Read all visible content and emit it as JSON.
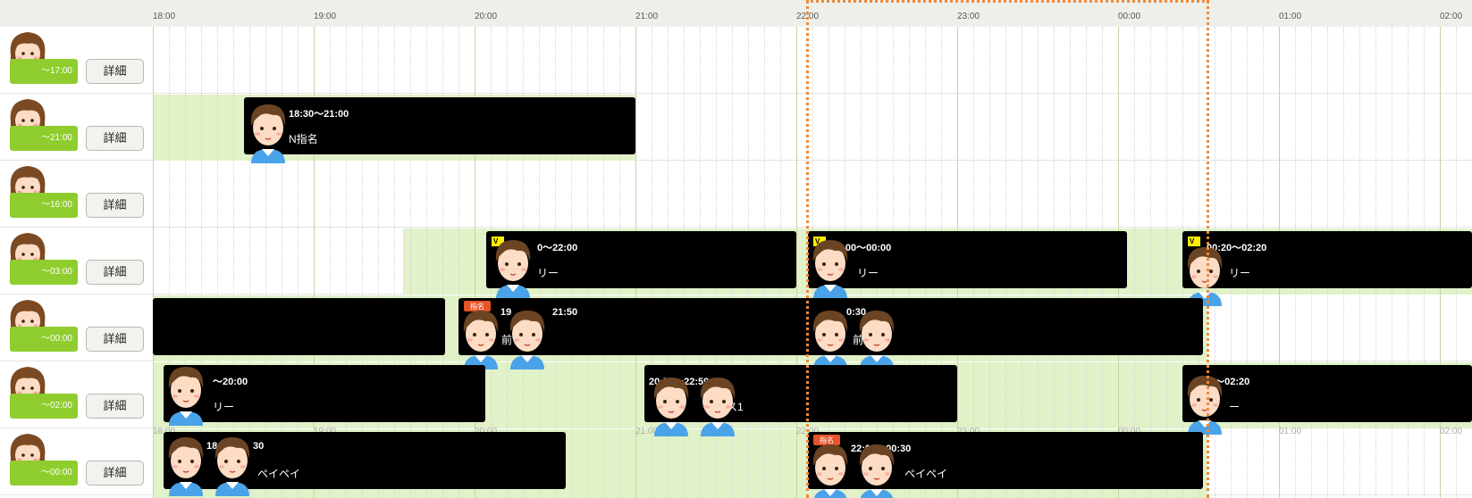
{
  "timeline": {
    "hours": [
      "18:00",
      "19:00",
      "20:00",
      "21:00",
      "22:00",
      "23:00",
      "00:00",
      "01:00",
      "02:00"
    ]
  },
  "staff": [
    {
      "shift": "〜17:00",
      "detail_label": "詳細"
    },
    {
      "shift": "〜21:00",
      "detail_label": "詳細"
    },
    {
      "shift": "〜16:00",
      "detail_label": "詳細"
    },
    {
      "shift": "〜03:00",
      "detail_label": "詳細"
    },
    {
      "shift": "〜00:00",
      "detail_label": "詳細"
    },
    {
      "shift": "〜02:00",
      "detail_label": "詳細"
    },
    {
      "shift": "〜00:00",
      "detail_label": "詳細"
    }
  ],
  "bookings": [
    {
      "time": "18:30〜21:00",
      "text": "N指名"
    },
    {
      "time": "0〜22:00",
      "text": "リー"
    },
    {
      "time": "22:00〜00:00",
      "text": "リー"
    },
    {
      "time": "00:20〜02:20",
      "text": "リー"
    },
    {
      "time": "",
      "text": ""
    },
    {
      "time": "19",
      "text": "前"
    },
    {
      "time": "21:50",
      "text": ""
    },
    {
      "time": "0:30",
      "text": "前"
    },
    {
      "time": "〜20:00",
      "text": "リー"
    },
    {
      "time": "20:59〜22:59",
      "text": "ス1"
    },
    {
      "time": "0〜02:20",
      "text": "ー"
    },
    {
      "time": "18",
      "text": "ペイペイ"
    },
    {
      "time": "30",
      "text": ""
    },
    {
      "time": "22:00〜00:30",
      "text": "ペイペイ"
    }
  ],
  "tags": {
    "v": "V",
    "shimei": "指名"
  },
  "colors": {
    "header_bg": "#efefea",
    "availability": "#e1f1c8",
    "shift_badge": "#8fcd2e",
    "booking": "#000000",
    "now_marker": "#ef8a3a",
    "v_tag": "#ffee00"
  },
  "icons": {
    "staff": "female-staff-avatar-icon",
    "customer": "male-customer-avatar-icon"
  }
}
